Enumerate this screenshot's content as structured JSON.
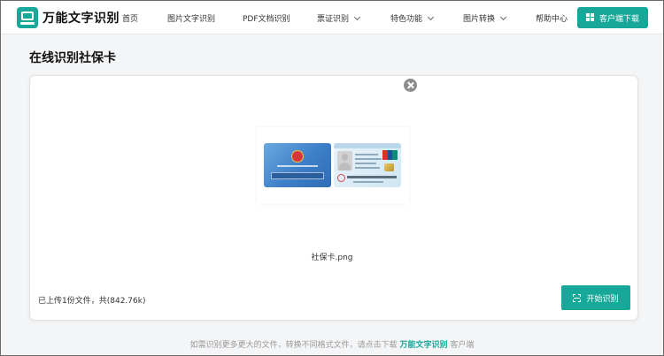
{
  "header": {
    "brand": "万能文字识别",
    "nav": [
      {
        "label": "首页",
        "dropdown": false
      },
      {
        "label": "图片文字识别",
        "dropdown": false
      },
      {
        "label": "PDF文档识别",
        "dropdown": false
      },
      {
        "label": "票证识别",
        "dropdown": true
      },
      {
        "label": "特色功能",
        "dropdown": true
      },
      {
        "label": "图片转换",
        "dropdown": true
      },
      {
        "label": "帮助中心",
        "dropdown": false
      }
    ],
    "download_label": "客户端下载",
    "accent_color": "#17a899"
  },
  "page": {
    "title": "在线识别社保卡"
  },
  "upload": {
    "file_name": "社保卡.png",
    "status": "已上传1份文件，共(842.76k)",
    "start_label": "开始识别"
  },
  "footer": {
    "note_before": "如需识别更多更大的文件，转换不同格式文件，请点击下载",
    "brand_link": "万能文字识别",
    "note_after": "客户端"
  }
}
